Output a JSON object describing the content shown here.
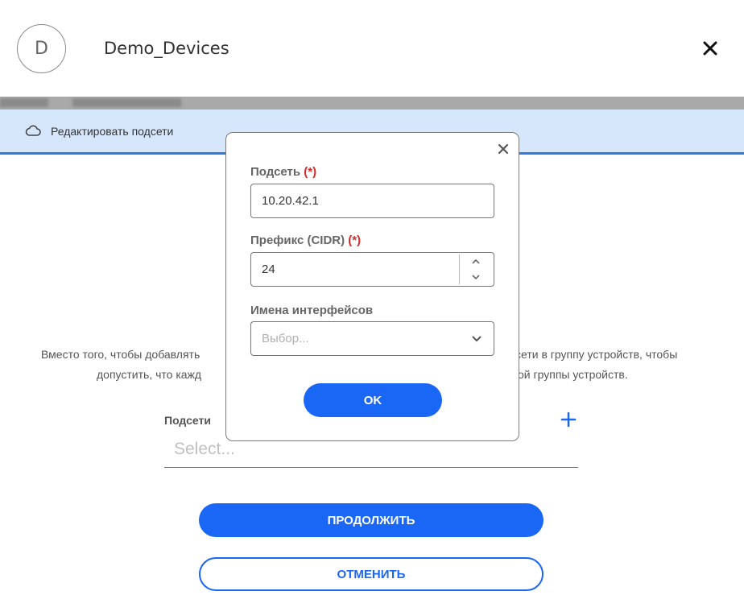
{
  "header": {
    "avatar_letter": "D",
    "title": "Demo_Devices"
  },
  "toolbar": {
    "label": "Редактировать подсети"
  },
  "description": {
    "line1_left": "Вместо того, чтобы добавлять",
    "line1_right": "сети в группу устройств, чтобы",
    "line2_left": "допустить, что кажд",
    "line2_right": "ой группы устройств."
  },
  "subnets": {
    "label": "Подсети",
    "placeholder": "Select..."
  },
  "buttons": {
    "continue": "ПРОДОЛЖИТЬ",
    "cancel": "ОТМЕНИТЬ"
  },
  "modal": {
    "subnet_label": "Подсеть",
    "subnet_required": "(*)",
    "subnet_value": "10.20.42.1",
    "prefix_label": "Префикс (CIDR)",
    "prefix_required": "(*)",
    "prefix_value": "24",
    "interfaces_label": "Имена интерфейсов",
    "interfaces_placeholder": "Выбор...",
    "ok": "OK"
  },
  "colors": {
    "accent": "#1a66f5",
    "toolbar_bg": "#d6e6fb",
    "required": "#d62828"
  }
}
